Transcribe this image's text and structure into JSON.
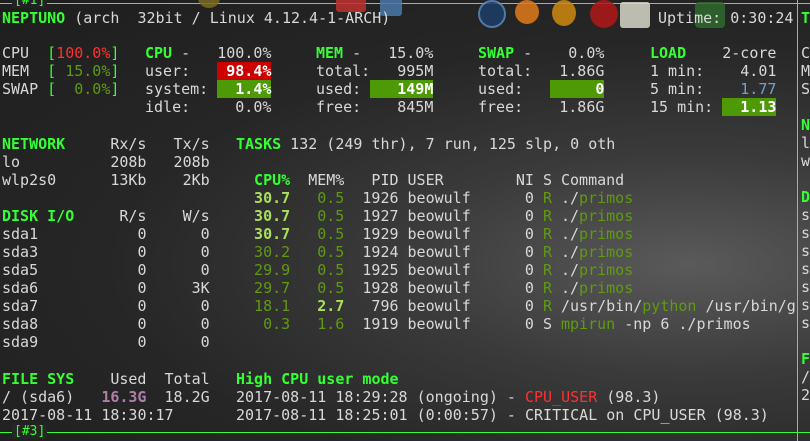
{
  "window": {
    "top_tag": "[#1]",
    "bottom_tag": "[#3]"
  },
  "colors": {
    "accent": "#33ff33",
    "dim_green": "#5f9a12",
    "critical_bg": "#cc0000",
    "ok_bg": "#4e9a06",
    "careful": "#729fcf",
    "warning": "#ad7fa8"
  },
  "header": {
    "hostname": "NEPTUNO",
    "system": " (arch  32bit / Linux 4.12.4-1-ARCH)",
    "uptime": "Uptime: 0:30:24"
  },
  "quicklook": [
    {
      "label": "CPU",
      "value": "100.0%",
      "level": "critical"
    },
    {
      "label": "MEM",
      "value": " 15.0%",
      "level": "ok"
    },
    {
      "label": "SWAP",
      "value": "  0.0%",
      "level": "ok"
    }
  ],
  "cpu": {
    "title": "CPU",
    "dash": "-",
    "total": "100.0%",
    "rows": [
      {
        "label": "user:",
        "value": "98.4%"
      },
      {
        "label": "system:",
        "value": "1.4%"
      },
      {
        "label": "idle:",
        "value": "0.0%"
      }
    ]
  },
  "mem": {
    "title": "MEM",
    "dash": "-",
    "total": "15.0%",
    "rows": [
      {
        "label": "total:",
        "value": "995M"
      },
      {
        "label": "used:",
        "value": "149M"
      },
      {
        "label": "free:",
        "value": "845M"
      }
    ]
  },
  "swap": {
    "title": "SWAP",
    "dash": "-",
    "total": "0.0%",
    "rows": [
      {
        "label": "total:",
        "value": "1.86G"
      },
      {
        "label": "used:",
        "value": "0"
      },
      {
        "label": "free:",
        "value": "1.86G"
      }
    ]
  },
  "load": {
    "title": "LOAD",
    "cores": "2-core",
    "rows": [
      {
        "label": "1 min:",
        "value": "4.01"
      },
      {
        "label": "5 min:",
        "value": "1.77"
      },
      {
        "label": "15 min:",
        "value": "1.13"
      }
    ]
  },
  "network": {
    "title": "NETWORK",
    "rx": "Rx/s",
    "tx": "Tx/s",
    "rows": [
      {
        "name": "lo",
        "rx": "208b",
        "tx": "208b"
      },
      {
        "name": "wlp2s0",
        "rx": "13Kb",
        "tx": "2Kb"
      }
    ]
  },
  "disk": {
    "title": "DISK I/O",
    "r": "R/s",
    "w": "W/s",
    "rows": [
      {
        "name": "sda1",
        "r": "0",
        "w": "0"
      },
      {
        "name": "sda3",
        "r": "0",
        "w": "0"
      },
      {
        "name": "sda5",
        "r": "0",
        "w": "0"
      },
      {
        "name": "sda6",
        "r": "0",
        "w": "3K"
      },
      {
        "name": "sda7",
        "r": "0",
        "w": "0"
      },
      {
        "name": "sda8",
        "r": "0",
        "w": "0"
      },
      {
        "name": "sda9",
        "r": "0",
        "w": "0"
      }
    ]
  },
  "tasks": {
    "title": "TASKS",
    "summary": " 132 (249 thr), 7 run, 125 slp, 0 oth"
  },
  "processes": {
    "columns": {
      "cpu": "CPU%",
      "mem": "MEM%",
      "pid": "PID",
      "user": "USER",
      "ni": "NI",
      "s": "S",
      "command": "Command"
    },
    "rows": [
      {
        "cpu": "30.7",
        "mem": "0.5",
        "pid": "1926",
        "user": "beowulf",
        "ni": "0",
        "s": "R",
        "cmd_pre": "./",
        "cmd_prog": "primos",
        "cmd_args": "",
        "cpu_level": "high",
        "mem_level": "low"
      },
      {
        "cpu": "30.7",
        "mem": "0.5",
        "pid": "1927",
        "user": "beowulf",
        "ni": "0",
        "s": "R",
        "cmd_pre": "./",
        "cmd_prog": "primos",
        "cmd_args": "",
        "cpu_level": "high",
        "mem_level": "low"
      },
      {
        "cpu": "30.7",
        "mem": "0.5",
        "pid": "1929",
        "user": "beowulf",
        "ni": "0",
        "s": "R",
        "cmd_pre": "./",
        "cmd_prog": "primos",
        "cmd_args": "",
        "cpu_level": "high",
        "mem_level": "low"
      },
      {
        "cpu": "30.2",
        "mem": "0.5",
        "pid": "1924",
        "user": "beowulf",
        "ni": "0",
        "s": "R",
        "cmd_pre": "./",
        "cmd_prog": "primos",
        "cmd_args": "",
        "cpu_level": "low",
        "mem_level": "low"
      },
      {
        "cpu": "29.9",
        "mem": "0.5",
        "pid": "1925",
        "user": "beowulf",
        "ni": "0",
        "s": "R",
        "cmd_pre": "./",
        "cmd_prog": "primos",
        "cmd_args": "",
        "cpu_level": "low",
        "mem_level": "low"
      },
      {
        "cpu": "29.7",
        "mem": "0.5",
        "pid": "1928",
        "user": "beowulf",
        "ni": "0",
        "s": "R",
        "cmd_pre": "./",
        "cmd_prog": "primos",
        "cmd_args": "",
        "cpu_level": "low",
        "mem_level": "low"
      },
      {
        "cpu": "18.1",
        "mem": "2.7",
        "pid": "796",
        "user": "beowulf",
        "ni": "0",
        "s": "R",
        "cmd_pre": "/usr/bin/",
        "cmd_prog": "python",
        "cmd_args": " /usr/bin/g",
        "cpu_level": "low",
        "mem_level": "high"
      },
      {
        "cpu": "0.3",
        "mem": "1.6",
        "pid": "1919",
        "user": "beowulf",
        "ni": "0",
        "s": "S",
        "cmd_pre": "",
        "cmd_prog": "mpirun",
        "cmd_args": " -np 6 ./primos",
        "cpu_level": "low",
        "mem_level": "low"
      }
    ]
  },
  "filesys": {
    "title": "FILE SYS",
    "used": "Used",
    "total": "Total",
    "rows": [
      {
        "name": "/ (sda6)",
        "used": "16.3G",
        "total": "18.2G"
      }
    ]
  },
  "timestamp": "2017-08-11 18:30:17",
  "alerts": {
    "title": "High CPU user mode",
    "rows": [
      {
        "time": "2017-08-11 18:29:28 (ongoing) - ",
        "type": "CPU_USER",
        "detail": " (98.3)",
        "state": "ongoing"
      },
      {
        "time": "2017-08-11 18:25:01 (0:00:57) - ",
        "type": "CRITICAL on CPU_USER",
        "detail": " (98.3)",
        "state": "past"
      }
    ]
  },
  "right_pane": {
    "letters": [
      "T",
      "C",
      "M",
      "S",
      "N",
      "l",
      "w",
      "D",
      "s",
      "s",
      "s",
      "s",
      "s",
      "s",
      "s",
      "F",
      "/",
      "2"
    ]
  }
}
